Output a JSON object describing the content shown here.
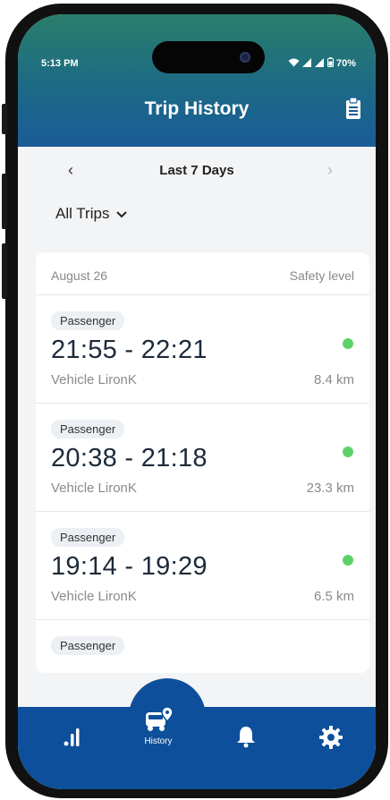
{
  "status_bar": {
    "time": "5:13 PM",
    "battery": "70%"
  },
  "header": {
    "title": "Trip History",
    "report_icon": "clipboard-icon"
  },
  "date_range": {
    "label": "Last 7 Days",
    "prev_icon": "chevron-left-icon",
    "next_icon": "chevron-right-icon"
  },
  "filter": {
    "label": "All Trips",
    "icon": "chevron-down-icon"
  },
  "trips_section": {
    "date": "August 26",
    "column_label": "Safety level",
    "trips": [
      {
        "role": "Passenger",
        "time": "21:55 - 22:21",
        "vehicle": "Vehicle  LironK",
        "distance": "8.4 km",
        "safety_color": "#5cd16a"
      },
      {
        "role": "Passenger",
        "time": "20:38 - 21:18",
        "vehicle": "Vehicle  LironK",
        "distance": "23.3 km",
        "safety_color": "#5cd16a"
      },
      {
        "role": "Passenger",
        "time": "19:14 - 19:29",
        "vehicle": "Vehicle  LironK",
        "distance": "6.5 km",
        "safety_color": "#5cd16a"
      },
      {
        "role": "Passenger"
      }
    ]
  },
  "bottom_nav": {
    "items": [
      {
        "icon": "bar-chart-icon"
      },
      {
        "icon": "car-pin-icon",
        "label": "History"
      },
      {
        "icon": "bell-icon"
      },
      {
        "icon": "gear-icon"
      }
    ]
  },
  "colors": {
    "header_top": "#2a7e6b",
    "header_bottom": "#1a5c98",
    "nav_bg": "#0d4f9a",
    "safe": "#5cd16a"
  }
}
